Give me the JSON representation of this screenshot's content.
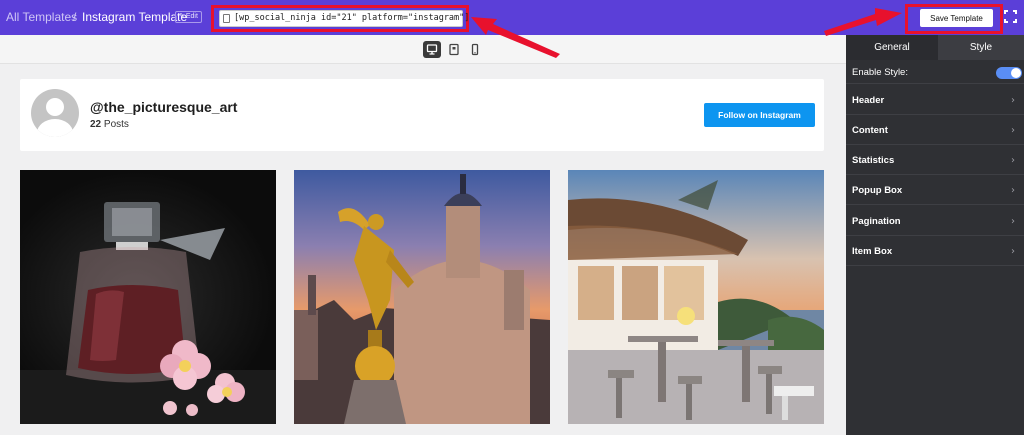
{
  "breadcrumb": {
    "root": "All Templates",
    "separator": "/",
    "current": "Instagram Template",
    "edit_label": "Edit"
  },
  "shortcode": {
    "value": "[wp_social_ninja id=\"21\" platform=\"instagram\"]"
  },
  "toolbar": {
    "save_label": "Save Template"
  },
  "devices": [
    "desktop-icon",
    "tablet-icon",
    "mobile-icon"
  ],
  "profile": {
    "username": "@the_picturesque_art",
    "post_count": "22",
    "posts_label": "Posts",
    "follow_label": "Follow on Instagram"
  },
  "posts": [
    {
      "icon": "perfume-bottle-photo"
    },
    {
      "icon": "golden-angel-dome-photo"
    },
    {
      "icon": "seaside-terrace-photo"
    }
  ],
  "sidebar": {
    "tabs": [
      {
        "label": "General",
        "active": false
      },
      {
        "label": "Style",
        "active": true
      }
    ],
    "enable_style": {
      "label": "Enable Style:",
      "enabled": true
    },
    "sections": [
      {
        "label": "Header"
      },
      {
        "label": "Content"
      },
      {
        "label": "Statistics"
      },
      {
        "label": "Popup Box"
      },
      {
        "label": "Pagination"
      },
      {
        "label": "Item Box"
      }
    ]
  },
  "colors": {
    "topbar": "#5b3fd8",
    "highlight": "#e8112d",
    "follow_button": "#0d95f0",
    "sidebar": "#2f3034",
    "toggle_on": "#5a8ef5"
  }
}
